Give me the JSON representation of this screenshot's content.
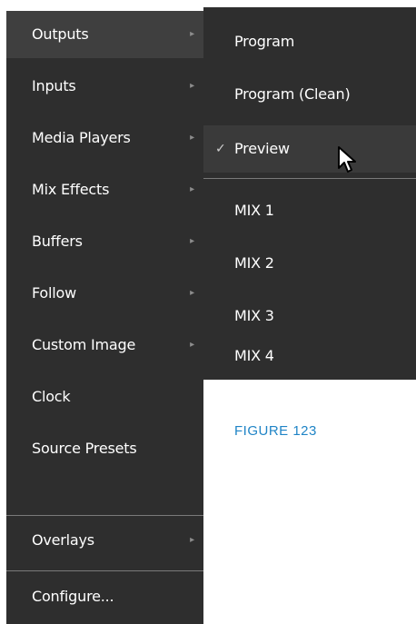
{
  "main_menu": {
    "items": [
      {
        "label": "Outputs",
        "has_submenu": true
      },
      {
        "label": "Inputs",
        "has_submenu": true
      },
      {
        "label": "Media Players",
        "has_submenu": true
      },
      {
        "label": "Mix Effects",
        "has_submenu": true
      },
      {
        "label": "Buffers",
        "has_submenu": true
      },
      {
        "label": "Follow",
        "has_submenu": true
      },
      {
        "label": "Custom Image",
        "has_submenu": true
      },
      {
        "label": "Clock",
        "has_submenu": false
      },
      {
        "label": "Source Presets",
        "has_submenu": false
      },
      {
        "label": "Overlays",
        "has_submenu": true
      },
      {
        "label": "Configure...",
        "has_submenu": false
      }
    ],
    "arrow_glyph": "▸"
  },
  "submenu": {
    "items": [
      {
        "label": "Program"
      },
      {
        "label": "Program (Clean)"
      },
      {
        "label": "Preview",
        "checked": true
      },
      {
        "label": "MIX 1"
      },
      {
        "label": "MIX 2"
      },
      {
        "label": "MIX 3"
      },
      {
        "label": "MIX 4"
      }
    ],
    "check_glyph": "✓"
  },
  "caption": "FIGURE 123",
  "colors": {
    "menu_bg": "#2e2e2e",
    "active_bg": "#3f3f3f",
    "caption": "#1f84c6"
  }
}
